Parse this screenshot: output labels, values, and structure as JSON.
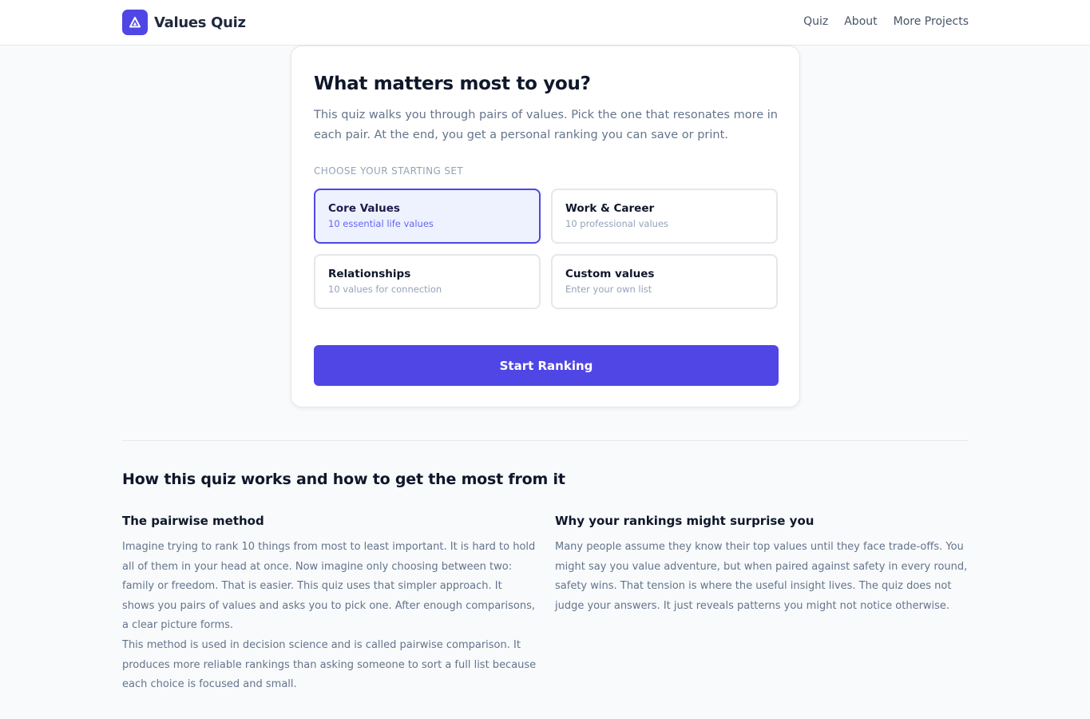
{
  "header": {
    "app_name": "Values Quiz",
    "logo_icon": "triangle-logo-icon",
    "nav": [
      "Quiz",
      "About",
      "More Projects"
    ]
  },
  "card": {
    "title": "What matters most to you?",
    "intro": "This quiz walks you through pairs of values. Pick the one that resonates more in each pair. At the end, you get a personal ranking you can save or print.",
    "set_label": "CHOOSE YOUR STARTING SET",
    "options": [
      {
        "title": "Core Values",
        "subtitle": "10 essential life values",
        "selected": true
      },
      {
        "title": "Work & Career",
        "subtitle": "10 professional values",
        "selected": false
      },
      {
        "title": "Relationships",
        "subtitle": "10 values for connection",
        "selected": false
      },
      {
        "title": "Custom values",
        "subtitle": "Enter your own list",
        "selected": false
      }
    ],
    "start_label": "Start Ranking"
  },
  "info": {
    "title": "How this quiz works and how to get the most from it",
    "left": {
      "heading": "The pairwise method",
      "paragraphs": [
        "Imagine trying to rank 10 things from most to least important. It is hard to hold all of them in your head at once. Now imagine only choosing between two: family or freedom. That is easier. This quiz uses that simpler approach. It shows you pairs of values and asks you to pick one. After enough comparisons, a clear picture forms.",
        "This method is used in decision science and is called pairwise comparison. It produces more reliable rankings than asking someone to sort a full list because each choice is focused and small."
      ]
    },
    "right": {
      "heading": "Why your rankings might surprise you",
      "paragraphs": [
        "Many people assume they know their top values until they face trade-offs. You might say you value adventure, but when paired against safety in every round, safety wins. That tension is where the useful insight lives. The quiz does not judge your answers. It just reveals patterns you might not notice otherwise."
      ]
    }
  },
  "colors": {
    "accent": "#4f46e5",
    "selected_bg": "#eef2ff",
    "page_bg": "#f8fafc",
    "muted_text": "#64748b"
  }
}
